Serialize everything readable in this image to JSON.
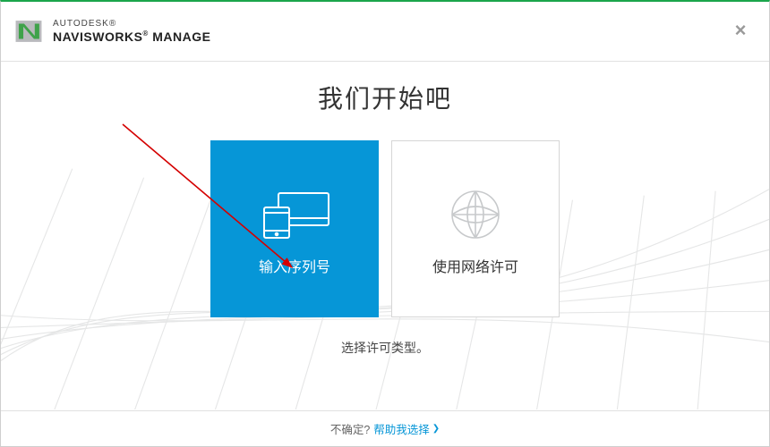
{
  "brand": {
    "company": "AUTODESK",
    "product": "NAVISWORKS",
    "edition": "MANAGE",
    "reg": "®"
  },
  "headline": "我们开始吧",
  "tiles": {
    "serial": {
      "label": "输入序列号",
      "iconName": "devices-icon"
    },
    "network": {
      "label": "使用网络许可",
      "iconName": "globe-icon"
    }
  },
  "subtitle": "选择许可类型。",
  "footer": {
    "question": "不确定?",
    "helpLabel": "帮助我选择"
  },
  "colors": {
    "accent": "#0696d7",
    "topBar": "#1aa54b"
  }
}
